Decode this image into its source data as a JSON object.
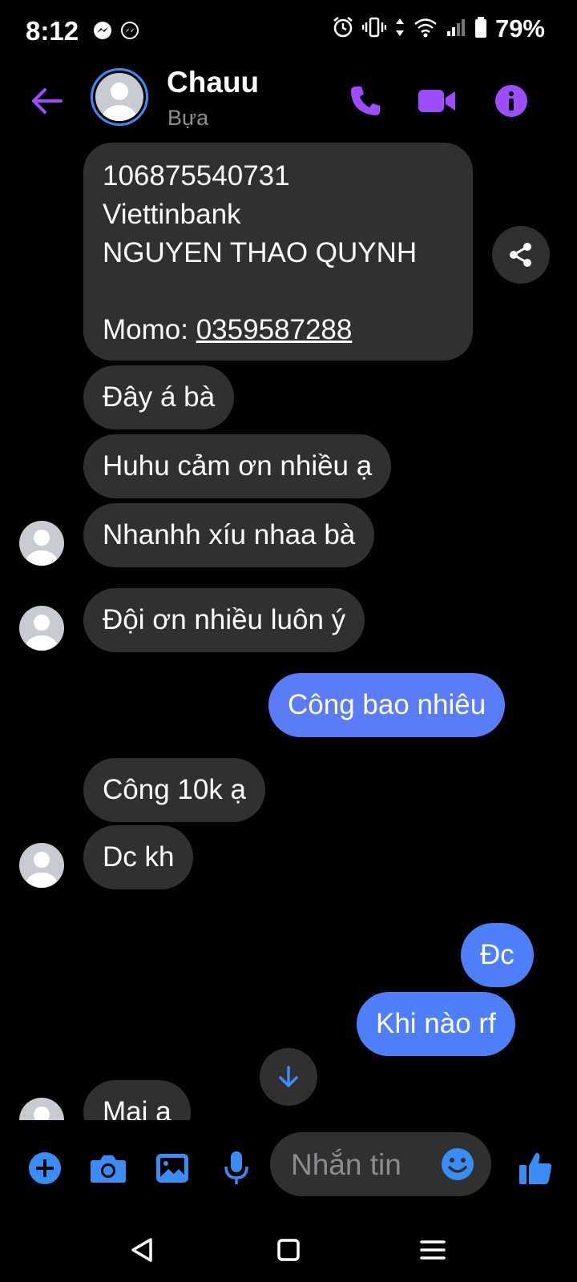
{
  "status_bar": {
    "time": "8:12",
    "battery": "79%",
    "icons": [
      "messenger-icon",
      "messenger-icon",
      "alarm-icon",
      "vibrate-icon",
      "data-icon",
      "wifi-icon",
      "signal-icon",
      "battery-icon"
    ]
  },
  "header": {
    "name": "Chauu",
    "subtitle": "Bựa",
    "icons": [
      "back-arrow-icon",
      "phone-icon",
      "video-call-icon",
      "info-icon"
    ],
    "accent": "#9b4dff"
  },
  "messages": {
    "m1_line1": "106875540731",
    "m1_line2": "Viettinbank",
    "m1_line3": "NGUYEN THAO QUYNH",
    "m1_momo_prefix": "Momo: ",
    "m1_momo_number": "0359587288",
    "m2": "Đây á bà",
    "m3": "Huhu cảm ơn nhiều ạ",
    "m4": "Nhanhh xíu nhaa bà",
    "m5": "Đội ơn nhiều luôn ý",
    "m6": "Công bao nhiêu",
    "m7": "Công 10k ạ",
    "m8": "Dc kh",
    "m9": "Đc",
    "m10": "Khi nào rf",
    "m11": "Mai a"
  },
  "composer": {
    "placeholder": "Nhắn tin",
    "icons": [
      "plus-icon",
      "camera-icon",
      "gallery-icon",
      "microphone-icon",
      "emoji-icon",
      "thumbs-up-icon"
    ],
    "accent": "#3b8cf5"
  },
  "colors": {
    "incoming_bubble": "#303030",
    "outgoing_bubble_top": "#5b7cf7",
    "outgoing_bubble_bottom": "#4e7ef9",
    "background": "#000000"
  }
}
